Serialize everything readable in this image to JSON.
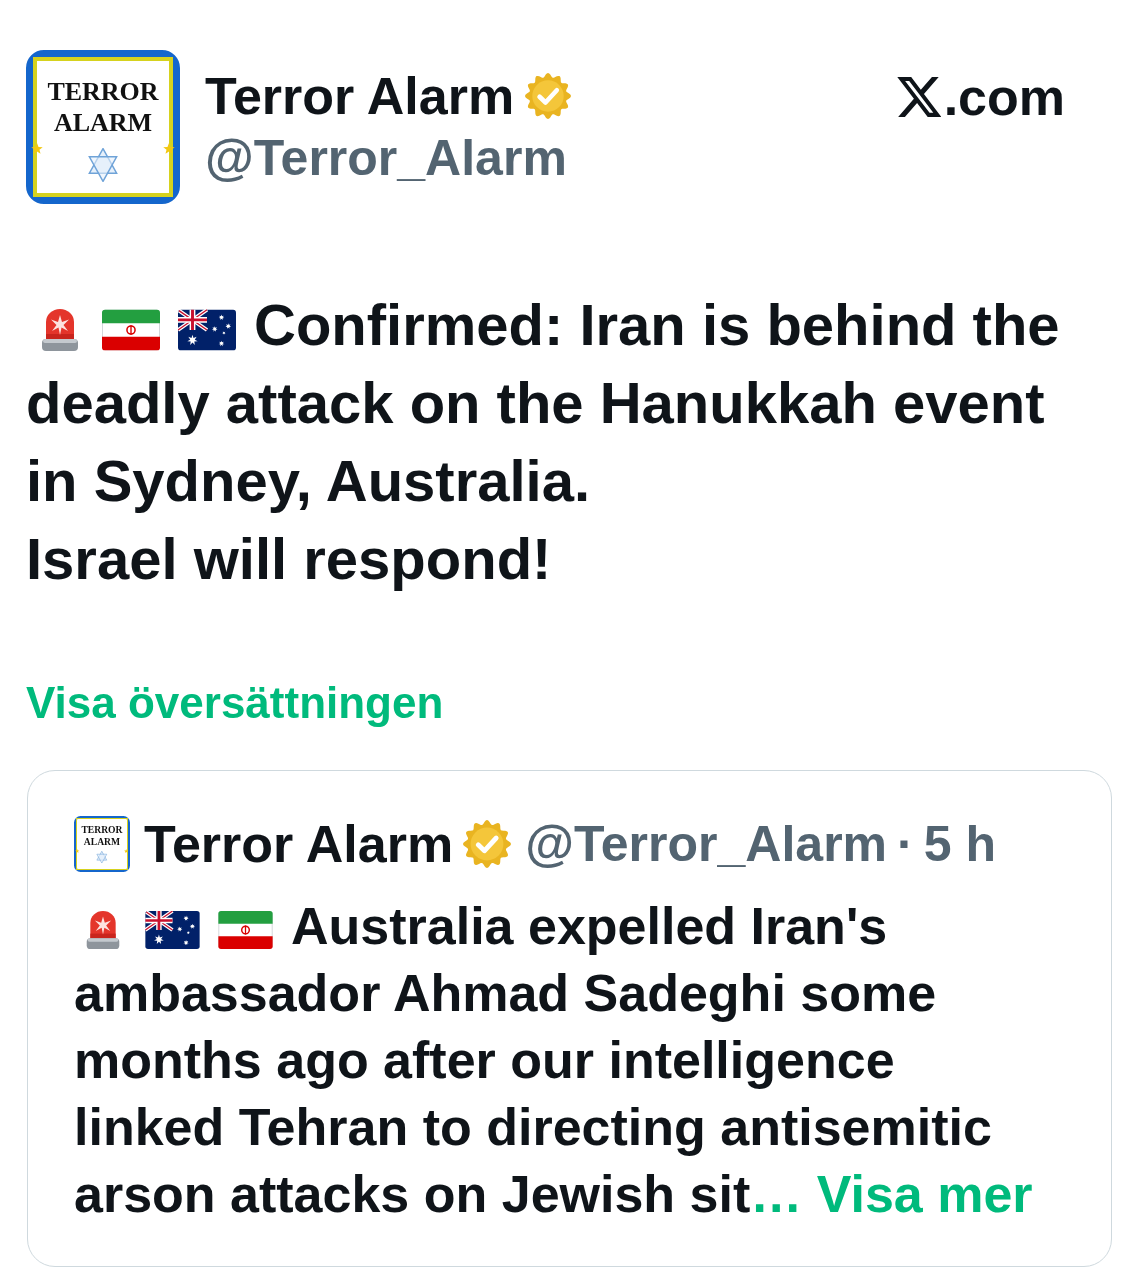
{
  "header": {
    "avatar_text": "TERROR\nALARM",
    "name": "Terror Alarm",
    "verified": true,
    "handle": "@Terror_Alarm",
    "site_suffix": ".com"
  },
  "post": {
    "emojis": [
      {
        "kind": "siren"
      },
      {
        "kind": "iran"
      },
      {
        "kind": "australia"
      }
    ],
    "lead_text": "Confirmed: Iran is behind the",
    "text": "deadly attack on the Hanukkah event in Sydney, Australia.\nIsrael will respond!",
    "translation_link": "Visa översättningen"
  },
  "quoted_post": {
    "author": {
      "avatar_text": "TERROR\nALARM",
      "name": "Terror Alarm",
      "verified": true,
      "handle": "@Terror_Alarm",
      "separator": "·",
      "time": "5 h"
    },
    "emojis": [
      {
        "kind": "siren"
      },
      {
        "kind": "australia"
      },
      {
        "kind": "iran"
      }
    ],
    "lead_text": "Australia expelled Iran's",
    "text": "ambassador Ahmad Sadeghi some months ago after our intelligence linked Tehran to directing antisemitic arson attacks on Jewish sit",
    "more_link": "… Visa mer"
  }
}
